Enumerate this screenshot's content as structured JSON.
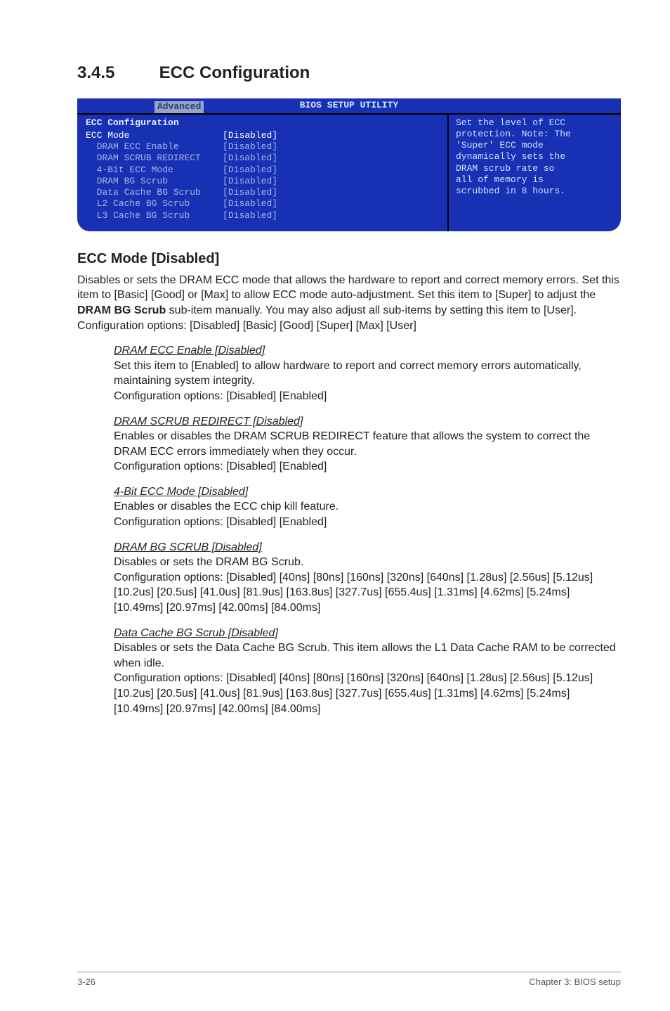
{
  "section": {
    "number": "3.4.5",
    "title": "ECC Configuration"
  },
  "bios": {
    "title": "BIOS SETUP UTILITY",
    "tab": "Advanced",
    "heading": "ECC Configuration",
    "help": [
      "Set the level of ECC",
      "protection. Note: The",
      "'Super' ECC mode",
      "dynamically sets the",
      "DRAM scrub rate so",
      "all of memory is",
      "scrubbed in 8 hours."
    ],
    "items": [
      {
        "label": "ECC Mode",
        "value": "[Disabled]",
        "indent": 0,
        "selected": true
      },
      {
        "label": "DRAM ECC Enable",
        "value": "[Disabled]",
        "indent": 1,
        "selected": false
      },
      {
        "label": "DRAM SCRUB REDIRECT",
        "value": "[Disabled]",
        "indent": 1,
        "selected": false
      },
      {
        "label": "4-Bit ECC Mode",
        "value": "[Disabled]",
        "indent": 1,
        "selected": false
      },
      {
        "label": "DRAM BG Scrub",
        "value": "[Disabled]",
        "indent": 1,
        "selected": false
      },
      {
        "label": "Data Cache BG Scrub",
        "value": "[Disabled]",
        "indent": 1,
        "selected": false
      },
      {
        "label": "L2 Cache BG Scrub",
        "value": "[Disabled]",
        "indent": 1,
        "selected": false
      },
      {
        "label": "L3 Cache BG Scrub",
        "value": "[Disabled]",
        "indent": 1,
        "selected": false
      }
    ]
  },
  "main_block": {
    "heading": "ECC Mode [Disabled]",
    "body_html": "Disables or sets the DRAM ECC mode that allows the hardware to report and correct memory errors. Set this item to [Basic] [Good] or [Max] to allow ECC mode auto-adjustment. Set this item to [Super] to adjust the <b>DRAM BG Scrub</b> sub-item manually. You may also adjust all sub-items by setting this item to [User]. Configuration options: [Disabled] [Basic] [Good] [Super] [Max] [User]"
  },
  "subs": [
    {
      "title": "DRAM ECC Enable [Disabled]",
      "body": "Set this item to [Enabled] to allow hardware to report and correct memory errors automatically, maintaining system integrity.\nConfiguration options: [Disabled] [Enabled]"
    },
    {
      "title": "DRAM SCRUB REDIRECT [Disabled]",
      "body": "Enables or disables the DRAM SCRUB REDIRECT feature that allows the system to correct the DRAM ECC errors immediately when they occur.\nConfiguration options: [Disabled] [Enabled]"
    },
    {
      "title": "4-Bit ECC Mode [Disabled]",
      "body": "Enables or disables the ECC chip kill feature.\nConfiguration options: [Disabled] [Enabled]"
    },
    {
      "title": "DRAM BG SCRUB [Disabled]",
      "body": "Disables or sets the DRAM BG Scrub.\nConfiguration options: [Disabled] [40ns] [80ns] [160ns] [320ns] [640ns] [1.28us] [2.56us] [5.12us] [10.2us] [20.5us] [41.0us] [81.9us] [163.8us] [327.7us] [655.4us] [1.31ms] [4.62ms] [5.24ms] [10.49ms] [20.97ms] [42.00ms] [84.00ms]"
    },
    {
      "title": "Data Cache BG Scrub [Disabled]",
      "body": "Disables or sets the Data Cache BG Scrub. This item allows the L1 Data Cache RAM to be corrected when idle.\nConfiguration options: [Disabled] [40ns] [80ns] [160ns] [320ns] [640ns] [1.28us] [2.56us] [5.12us] [10.2us] [20.5us] [41.0us] [81.9us] [163.8us] [327.7us] [655.4us] [1.31ms] [4.62ms] [5.24ms] [10.49ms] [20.97ms] [42.00ms] [84.00ms]"
    }
  ],
  "footer": {
    "left": "3-26",
    "right": "Chapter 3: BIOS setup"
  }
}
